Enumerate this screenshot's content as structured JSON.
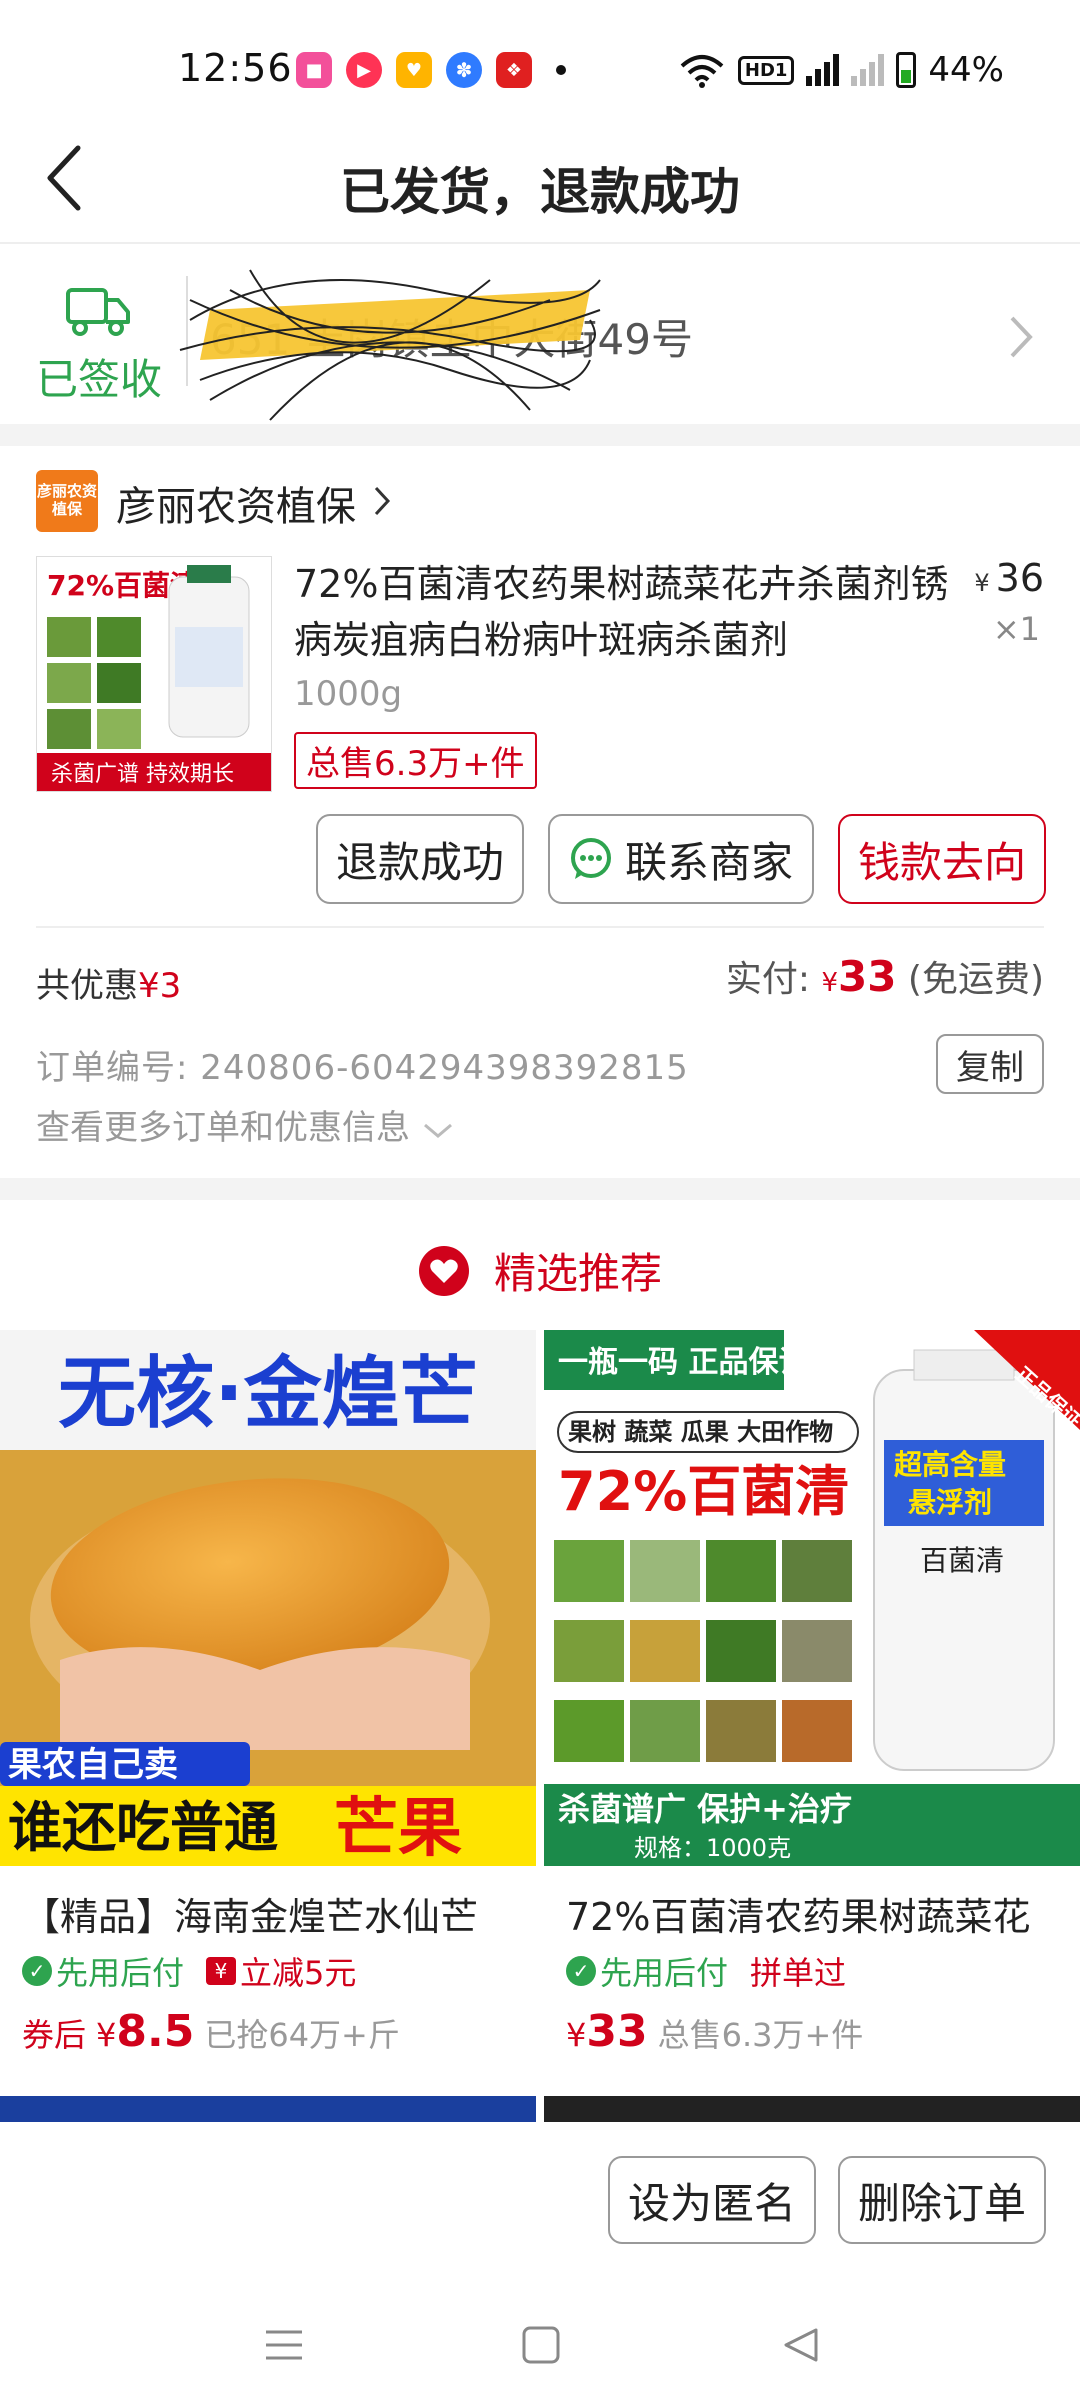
{
  "status_bar": {
    "time": "12:56",
    "battery": "44%",
    "hd": "HD1",
    "network": "5G"
  },
  "header": {
    "title": "已发货，退款成功"
  },
  "address": {
    "status": "已签收",
    "text": "651 圭岗镇圭中大街49号"
  },
  "store": {
    "logo_text": "彦丽农资植保",
    "name": "彦丽农资植保"
  },
  "product": {
    "title": "72%百菌清农药果树蔬菜花卉杀菌剂锈病炭疽病白粉病叶斑病杀菌剂",
    "spec": "1000g",
    "sales": "总售6.3万+件",
    "price_symbol": "¥",
    "price": "36",
    "qty": "×1",
    "img_top": "72%百菌清",
    "img_bottom": "杀菌广谱  持效期长"
  },
  "actions": {
    "refund": "退款成功",
    "contact": "联系商家",
    "money": "钱款去向"
  },
  "summary": {
    "discount_label": "共优惠",
    "discount_value": "¥3",
    "paid_label": "实付:",
    "paid_symbol": "¥",
    "paid_value": "33",
    "shipping": "(免运费)"
  },
  "order": {
    "number_label": "订单编号:",
    "number": "240806-604294398392815",
    "copy": "复制",
    "more": "查看更多订单和优惠信息"
  },
  "recommend": {
    "title": "精选推荐",
    "items": [
      {
        "img_headline": "无核·金煌芒",
        "img_tag": "果农自己卖",
        "img_slogan_a": "谁还吃普通",
        "img_slogan_b": "芒果",
        "title": "【精品】海南金煌芒水仙芒",
        "tag1": "先用后付",
        "tag2": "立减5元",
        "price_prefix": "券后",
        "price_symbol": "¥",
        "price": "8.5",
        "sold": "已抢64万+斤"
      },
      {
        "img_badge": "一瓶一码 正品保证",
        "img_crops": "果树 蔬菜 瓜果 大田作物",
        "img_name": "72%百菌清",
        "img_corner": "正品保证",
        "img_bottle_a": "超高含量",
        "img_bottle_b": "悬浮剂",
        "img_bottle_name": "百菌清",
        "img_footer": "杀菌谱广  保护+治疗",
        "img_spec": "规格：1000克",
        "title": "72%百菌清农药果树蔬菜花",
        "tag1": "先用后付",
        "tag2": "拼单过",
        "price_symbol": "¥",
        "price": "33",
        "sold": "总售6.3万+件"
      }
    ]
  },
  "bottom": {
    "anonymous": "设为匿名",
    "delete": "删除订单"
  },
  "colors": {
    "accent": "#d0021b",
    "green": "#2ea44f",
    "store": "#f07a1a"
  }
}
